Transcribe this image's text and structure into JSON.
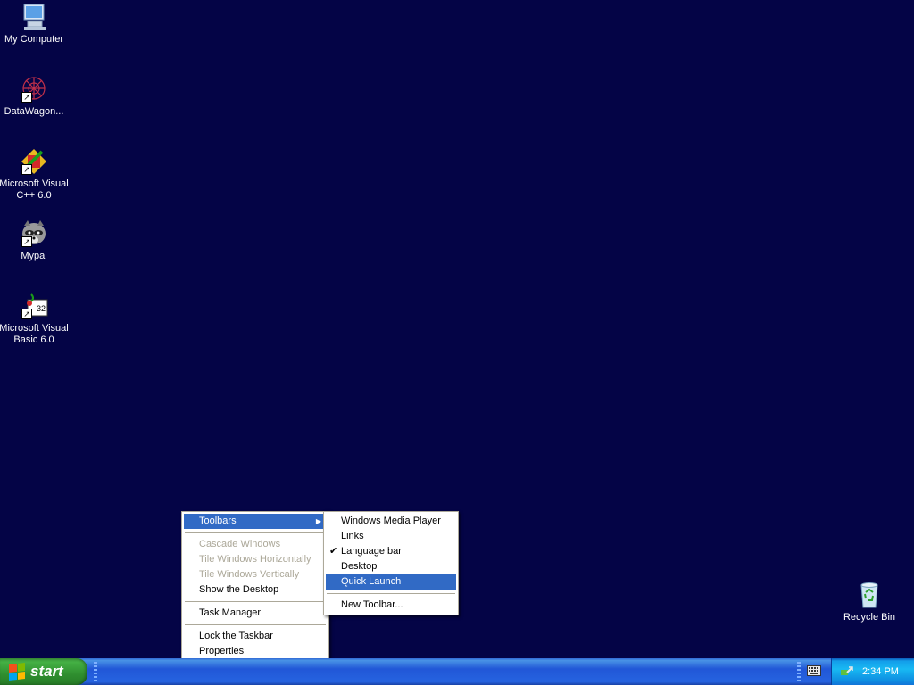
{
  "desktop": {
    "background_color": "#040446",
    "icons": [
      {
        "label": "My Computer",
        "icon": "computer-icon"
      },
      {
        "label": "DataWagon...",
        "icon": "datawagon-icon"
      },
      {
        "label": "Microsoft Visual C++ 6.0",
        "icon": "visual-cpp-icon"
      },
      {
        "label": "Mypal",
        "icon": "mypal-raccoon-icon"
      },
      {
        "label": "Microsoft Visual Basic 6.0",
        "icon": "visual-basic-icon"
      },
      {
        "label": "Recycle Bin",
        "icon": "recycle-bin-icon"
      }
    ]
  },
  "context_menu": {
    "items": [
      {
        "label": "Toolbars",
        "state": "highlighted",
        "submenu": true
      },
      {
        "label": "Cascade Windows",
        "state": "disabled"
      },
      {
        "label": "Tile Windows Horizontally",
        "state": "disabled"
      },
      {
        "label": "Tile Windows Vertically",
        "state": "disabled"
      },
      {
        "label": "Show the Desktop",
        "state": "enabled"
      },
      {
        "label": "Task Manager",
        "state": "enabled"
      },
      {
        "label": "Lock the Taskbar",
        "state": "enabled"
      },
      {
        "label": "Properties",
        "state": "enabled"
      }
    ]
  },
  "toolbars_submenu": {
    "items": [
      {
        "label": "Windows Media Player",
        "checked": false
      },
      {
        "label": "Links",
        "checked": false
      },
      {
        "label": "Language bar",
        "checked": true
      },
      {
        "label": "Desktop",
        "checked": false
      },
      {
        "label": "Quick Launch",
        "checked": false,
        "state": "highlighted"
      },
      {
        "label": "New Toolbar...",
        "checked": false
      }
    ]
  },
  "taskbar": {
    "start_label": "start",
    "clock": "2:34 PM",
    "tray_icons": [
      "keyboard-icon",
      "safely-remove-hardware-icon"
    ]
  },
  "colors": {
    "menu_highlight": "#316ac5",
    "disabled_text": "#aca899",
    "taskbar_blue": "#245edb",
    "start_green": "#3c9a3c"
  }
}
